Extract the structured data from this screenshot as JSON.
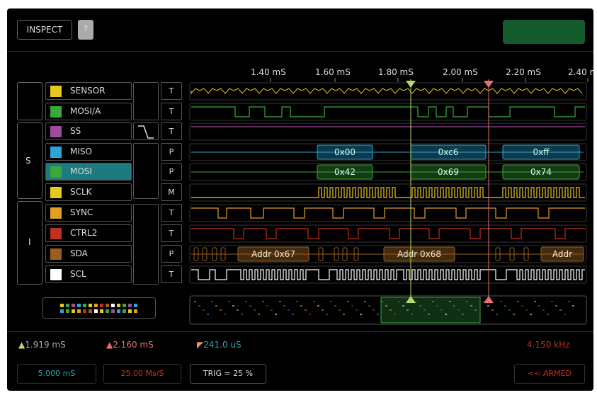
{
  "header": {
    "inspect_label": "INSPECT",
    "help_label": "?"
  },
  "timeline": {
    "ticks": [
      "1.40 mS",
      "1.60 mS",
      "1.80 mS",
      "2.00 mS",
      "2.20 mS",
      "2.40 m"
    ]
  },
  "groups": [
    {
      "label": ""
    },
    {
      "label": "S"
    },
    {
      "label": "I"
    }
  ],
  "channels": [
    {
      "name": "SENSOR",
      "color": "#e8c81e",
      "mode": "T"
    },
    {
      "name": "MOSI/A",
      "color": "#3aa83a",
      "mode": "T"
    },
    {
      "name": "SS",
      "color": "#a04aa0",
      "mode": "T"
    },
    {
      "name": "MISO",
      "color": "#2aa6d6",
      "mode": "P"
    },
    {
      "name": "MOSI",
      "color": "#3aa83a",
      "mode": "P"
    },
    {
      "name": "SCLK",
      "color": "#e8c81e",
      "mode": "M"
    },
    {
      "name": "SYNC",
      "color": "#e0a020",
      "mode": "T"
    },
    {
      "name": "CTRL2",
      "color": "#c03020",
      "mode": "T"
    },
    {
      "name": "SDA",
      "color": "#9a6020",
      "mode": "P"
    },
    {
      "name": "SCL",
      "color": "#ffffff",
      "mode": "T"
    }
  ],
  "decode": {
    "miso": [
      "0x00",
      "0xc6",
      "0xff"
    ],
    "mosi": [
      "0x42",
      "0x69",
      "0x74"
    ],
    "sda": [
      "Addr 0x67",
      "Addr 0x68",
      "Addr"
    ]
  },
  "measurements": {
    "cursor_a": "1.919 mS",
    "cursor_b": "2.160 mS",
    "delta": "241.0 uS",
    "frequency": "4.150 kHz"
  },
  "footer": {
    "timebase": "5.000 mS",
    "sample_rate": "25.00 Ms/S",
    "trigger": "TRIG = 25 %",
    "armed": "<< ARMED"
  },
  "colors": {
    "cursor_a": "#b8d870",
    "cursor_b": "#e87070",
    "armed": "#c03020",
    "timebase": "#2aa6b0"
  }
}
